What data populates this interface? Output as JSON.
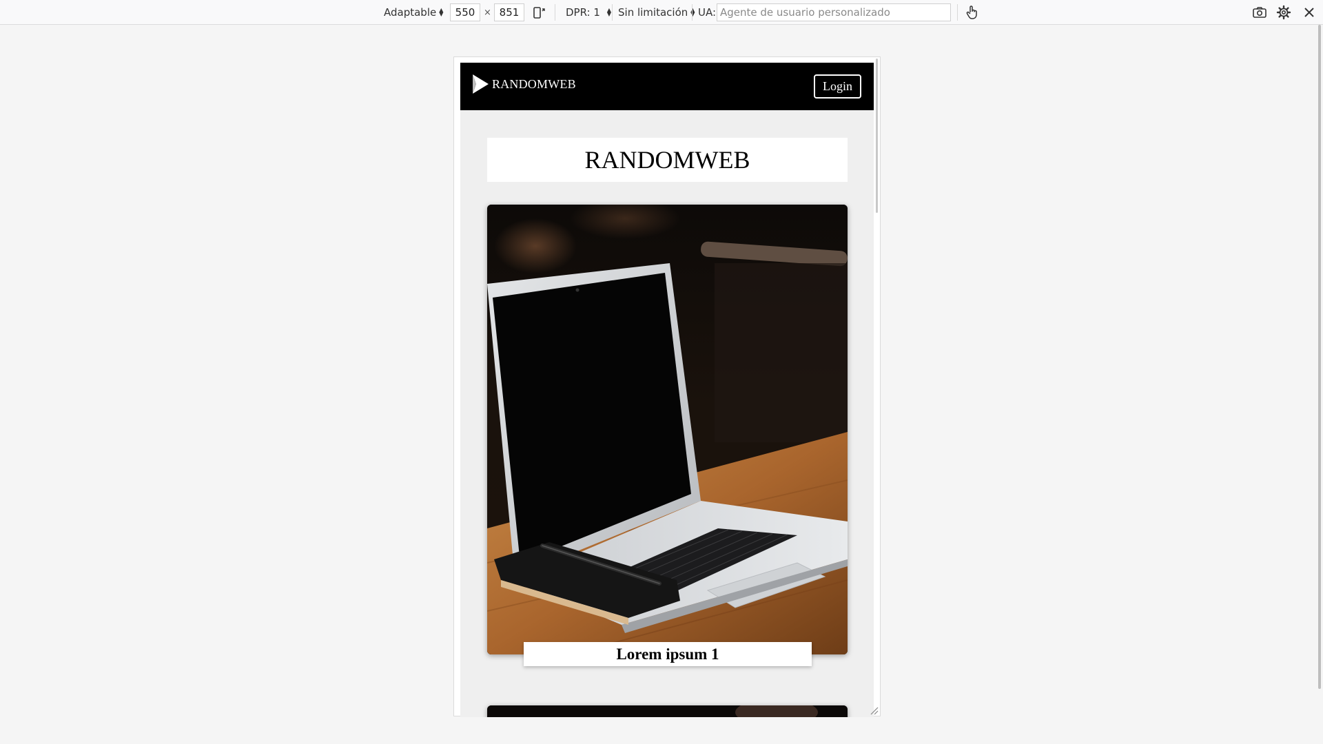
{
  "toolbar": {
    "device": "Adaptable",
    "width": "550",
    "times": "×",
    "height": "851",
    "dpr": "DPR: 1",
    "throttling": "Sin limitación",
    "ua_label": "UA:",
    "ua_placeholder": "Agente de usuario personalizado"
  },
  "site": {
    "brand": "RANDOMWEB",
    "login_label": "Login",
    "title": "RANDOMWEB",
    "cards": [
      {
        "caption": "Lorem ipsum 1"
      }
    ]
  },
  "colors": {
    "header_bg": "#000000",
    "page_bg": "#efefef"
  }
}
